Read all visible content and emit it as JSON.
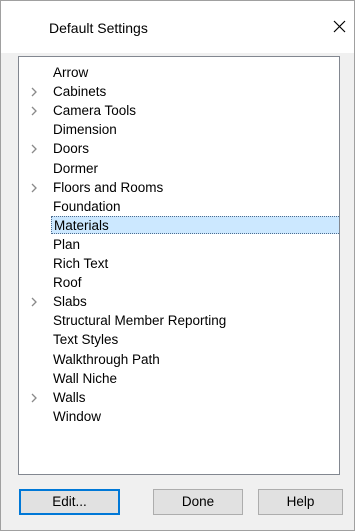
{
  "dialog": {
    "title": "Default Settings",
    "close_icon": "close-icon"
  },
  "tree": {
    "items": [
      {
        "label": "Arrow",
        "expandable": false
      },
      {
        "label": "Cabinets",
        "expandable": true
      },
      {
        "label": "Camera Tools",
        "expandable": true
      },
      {
        "label": "Dimension",
        "expandable": false
      },
      {
        "label": "Doors",
        "expandable": true
      },
      {
        "label": "Dormer",
        "expandable": false
      },
      {
        "label": "Floors and Rooms",
        "expandable": true
      },
      {
        "label": "Foundation",
        "expandable": false
      },
      {
        "label": "Materials",
        "expandable": false,
        "selected": true
      },
      {
        "label": "Plan",
        "expandable": false
      },
      {
        "label": "Rich Text",
        "expandable": false
      },
      {
        "label": "Roof",
        "expandable": false
      },
      {
        "label": "Slabs",
        "expandable": true
      },
      {
        "label": "Structural Member Reporting",
        "expandable": false
      },
      {
        "label": "Text Styles",
        "expandable": false
      },
      {
        "label": "Walkthrough Path",
        "expandable": false
      },
      {
        "label": "Wall Niche",
        "expandable": false
      },
      {
        "label": "Walls",
        "expandable": true
      },
      {
        "label": "Window",
        "expandable": false
      }
    ],
    "expand_icon": "chevron-right-icon"
  },
  "buttons": {
    "edit_label": "Edit...",
    "done_label": "Done",
    "help_label": "Help"
  },
  "colors": {
    "selection_background": "#cce8ff",
    "default_button_border": "#0078d7",
    "dialog_background": "#f0f0f0",
    "chevron": "#8a8a8a"
  }
}
